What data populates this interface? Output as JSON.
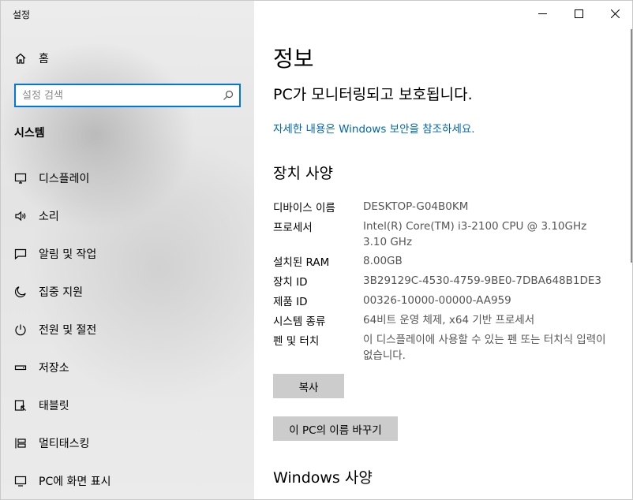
{
  "window": {
    "title": "설정"
  },
  "sidebar": {
    "home_label": "홈",
    "search_placeholder": "설정 검색",
    "section_label": "시스템",
    "items": [
      {
        "label": "디스플레이",
        "icon": "display-icon"
      },
      {
        "label": "소리",
        "icon": "speaker-icon"
      },
      {
        "label": "알림 및 작업",
        "icon": "notification-icon"
      },
      {
        "label": "집중 지원",
        "icon": "moon-icon"
      },
      {
        "label": "전원 및 절전",
        "icon": "power-icon"
      },
      {
        "label": "저장소",
        "icon": "storage-icon"
      },
      {
        "label": "태블릿",
        "icon": "tablet-icon"
      },
      {
        "label": "멀티태스킹",
        "icon": "multitasking-icon"
      },
      {
        "label": "PC에 화면 표시",
        "icon": "project-icon"
      }
    ]
  },
  "main": {
    "title": "정보",
    "status": "PC가 모니터링되고 보호됩니다.",
    "security_link": "자세한 내용은 Windows 보안을 참조하세요.",
    "device_specs_heading": "장치 사양",
    "specs": [
      {
        "label": "디바이스 이름",
        "value": "DESKTOP-G04B0KM"
      },
      {
        "label": "프로세서",
        "value": "Intel(R) Core(TM) i3-2100 CPU @ 3.10GHz   3.10 GHz"
      },
      {
        "label": "설치된 RAM",
        "value": "8.00GB"
      },
      {
        "label": "장치 ID",
        "value": "3B29129C-4530-4759-9BE0-7DBA648B1DE3"
      },
      {
        "label": "제품 ID",
        "value": "00326-10000-00000-AA959"
      },
      {
        "label": "시스템 종류",
        "value": "64비트 운영 체제, x64 기반 프로세서"
      },
      {
        "label": "펜 및 터치",
        "value": "이 디스플레이에 사용할 수 있는 펜 또는 터치식 입력이 없습니다."
      }
    ],
    "copy_button": "복사",
    "rename_button": "이 PC의 이름 바꾸기",
    "windows_specs_heading": "Windows 사양"
  }
}
